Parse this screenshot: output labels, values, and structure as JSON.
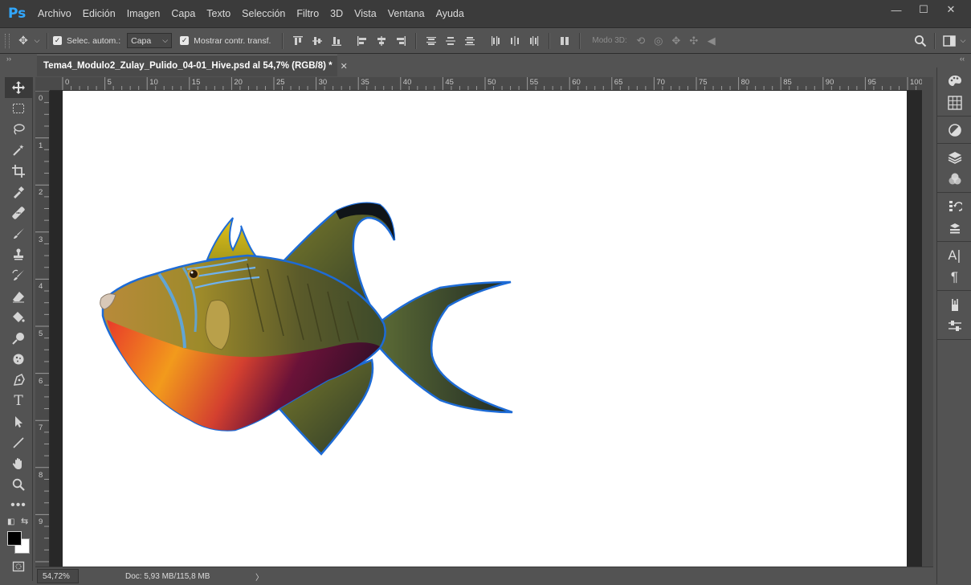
{
  "app": {
    "logo": "Ps"
  },
  "menu": [
    "Archivo",
    "Edición",
    "Imagen",
    "Capa",
    "Texto",
    "Selección",
    "Filtro",
    "3D",
    "Vista",
    "Ventana",
    "Ayuda"
  ],
  "window_controls": {
    "minimize": "—",
    "maximize": "☐",
    "close": "✕"
  },
  "options": {
    "auto_select_label": "Selec. autom.:",
    "auto_select_checked": true,
    "target_value": "Capa",
    "transform_label": "Mostrar contr. transf.",
    "transform_checked": true,
    "mode3d_label": "Modo 3D:"
  },
  "document": {
    "tab_title": "Tema4_Modulo2_Zulay_Pulido_04-01_Hive.psd al 54,7% (RGB/8) *",
    "close_glyph": "✕"
  },
  "rulers": {
    "top_labels": [
      "0",
      "5",
      "10",
      "15",
      "20",
      "25",
      "30",
      "35",
      "40",
      "45",
      "50",
      "55",
      "60",
      "65",
      "70",
      "75",
      "80",
      "85",
      "90",
      "95",
      "100"
    ],
    "left_labels": [
      "0",
      "1",
      "2",
      "3",
      "4",
      "5",
      "6",
      "7",
      "8",
      "9"
    ]
  },
  "status": {
    "zoom": "54,72%",
    "doc_info": "Doc: 5,93 MB/115,8 MB",
    "arrow": "〉"
  },
  "tools": [
    "move-tool-icon",
    "marquee-tool-icon",
    "lasso-tool-icon",
    "magic-wand-icon",
    "crop-tool-icon",
    "eyedropper-icon",
    "healing-brush-icon",
    "brush-tool-icon",
    "clone-stamp-icon",
    "history-brush-icon",
    "eraser-icon",
    "paint-bucket-icon",
    "dodge-tool-icon",
    "sponge-tool-icon",
    "pen-tool-icon",
    "type-tool-icon",
    "path-selection-icon",
    "line-tool-icon",
    "hand-tool-icon",
    "zoom-tool-icon",
    "more-tools-icon"
  ],
  "colors": {
    "foreground": "#000000",
    "background": "#ffffff",
    "accent": "#31a8ff"
  }
}
